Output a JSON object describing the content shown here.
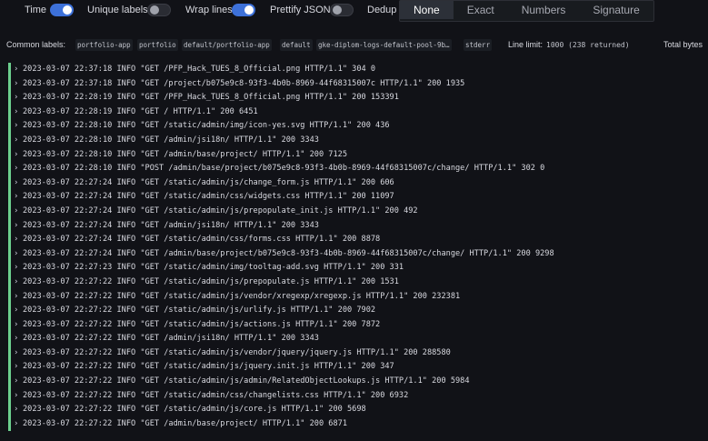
{
  "toolbar": {
    "time_label": "Time",
    "unique_labels_label": "Unique labels",
    "wrap_lines_label": "Wrap lines",
    "prettify_json_label": "Prettify JSON",
    "dedup_label": "Dedup",
    "dedup_options": [
      "None",
      "Exact",
      "Numbers",
      "Signature"
    ],
    "dedup_selected": "None",
    "time_on": true,
    "unique_labels_on": false,
    "wrap_lines_on": true,
    "prettify_json_on": false,
    "accent_color": "#3d71d9"
  },
  "labels": {
    "title": "Common labels:",
    "chips": [
      "portfolio-app",
      "portfolio",
      "default/portfolio-app",
      "default",
      "gke-diplom-logs-default-pool-9b…",
      "stderr"
    ],
    "line_limit_label": "Line limit:",
    "line_limit_value": "1000 (238 returned)",
    "total_bytes_label": "Total bytes"
  },
  "logs": [
    "2023-03-07 22:37:18 INFO \"GET /PFP_Hack_TUES_8_Official.png HTTP/1.1\" 304 0",
    "2023-03-07 22:37:18 INFO \"GET /project/b075e9c8-93f3-4b0b-8969-44f68315007c HTTP/1.1\" 200 1935",
    "2023-03-07 22:28:19 INFO \"GET /PFP_Hack_TUES_8_Official.png HTTP/1.1\" 200 153391",
    "2023-03-07 22:28:19 INFO \"GET / HTTP/1.1\" 200 6451",
    "2023-03-07 22:28:10 INFO \"GET /static/admin/img/icon-yes.svg HTTP/1.1\" 200 436",
    "2023-03-07 22:28:10 INFO \"GET /admin/jsi18n/ HTTP/1.1\" 200 3343",
    "2023-03-07 22:28:10 INFO \"GET /admin/base/project/ HTTP/1.1\" 200 7125",
    "2023-03-07 22:28:10 INFO \"POST /admin/base/project/b075e9c8-93f3-4b0b-8969-44f68315007c/change/ HTTP/1.1\" 302 0",
    "2023-03-07 22:27:24 INFO \"GET /static/admin/js/change_form.js HTTP/1.1\" 200 606",
    "2023-03-07 22:27:24 INFO \"GET /static/admin/css/widgets.css HTTP/1.1\" 200 11097",
    "2023-03-07 22:27:24 INFO \"GET /static/admin/js/prepopulate_init.js HTTP/1.1\" 200 492",
    "2023-03-07 22:27:24 INFO \"GET /admin/jsi18n/ HTTP/1.1\" 200 3343",
    "2023-03-07 22:27:24 INFO \"GET /static/admin/css/forms.css HTTP/1.1\" 200 8878",
    "2023-03-07 22:27:24 INFO \"GET /admin/base/project/b075e9c8-93f3-4b0b-8969-44f68315007c/change/ HTTP/1.1\" 200 9298",
    "2023-03-07 22:27:23 INFO \"GET /static/admin/img/tooltag-add.svg HTTP/1.1\" 200 331",
    "2023-03-07 22:27:22 INFO \"GET /static/admin/js/prepopulate.js HTTP/1.1\" 200 1531",
    "2023-03-07 22:27:22 INFO \"GET /static/admin/js/vendor/xregexp/xregexp.js HTTP/1.1\" 200 232381",
    "2023-03-07 22:27:22 INFO \"GET /static/admin/js/urlify.js HTTP/1.1\" 200 7902",
    "2023-03-07 22:27:22 INFO \"GET /static/admin/js/actions.js HTTP/1.1\" 200 7872",
    "2023-03-07 22:27:22 INFO \"GET /admin/jsi18n/ HTTP/1.1\" 200 3343",
    "2023-03-07 22:27:22 INFO \"GET /static/admin/js/vendor/jquery/jquery.js HTTP/1.1\" 200 288580",
    "2023-03-07 22:27:22 INFO \"GET /static/admin/js/jquery.init.js HTTP/1.1\" 200 347",
    "2023-03-07 22:27:22 INFO \"GET /static/admin/js/admin/RelatedObjectLookups.js HTTP/1.1\" 200 5984",
    "2023-03-07 22:27:22 INFO \"GET /static/admin/css/changelists.css HTTP/1.1\" 200 6932",
    "2023-03-07 22:27:22 INFO \"GET /static/admin/js/core.js HTTP/1.1\" 200 5698",
    "2023-03-07 22:27:22 INFO \"GET /admin/base/project/ HTTP/1.1\" 200 6871"
  ],
  "log_level_color": "#6ccf8e"
}
